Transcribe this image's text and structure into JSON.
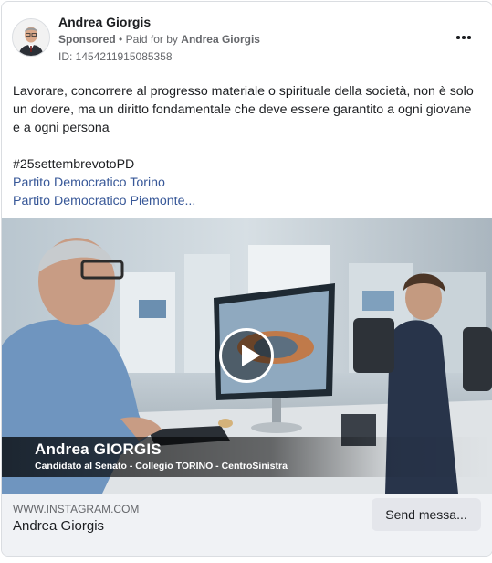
{
  "post": {
    "author": "Andrea Giorgis",
    "sponsored_label": "Sponsored",
    "separator": "•",
    "paid_for_prefix": "Paid for by",
    "paid_for_name": "Andrea Giorgis",
    "ad_id": "ID: 1454211915085358",
    "more_icon": "more-horizontal-icon",
    "body_line1": "Lavorare, concorrere al progresso materiale o spirituale della società, non è solo un dovere, ma un diritto fondamentale che deve essere garantito a ogni giovane e a ogni persona",
    "hashtag": "#25settembrevotoPD",
    "link1": "Partito Democratico Torino",
    "link2": "Partito Democratico Piemonte..."
  },
  "media": {
    "caption_name": "Andrea GIORGIS",
    "caption_sub": "Candidato al Senato - Collegio TORINO - CentroSinistra",
    "play_icon": "play-icon"
  },
  "footer": {
    "domain": "WWW.INSTAGRAM.COM",
    "title": "Andrea Giorgis",
    "cta_label": "Send messa..."
  }
}
